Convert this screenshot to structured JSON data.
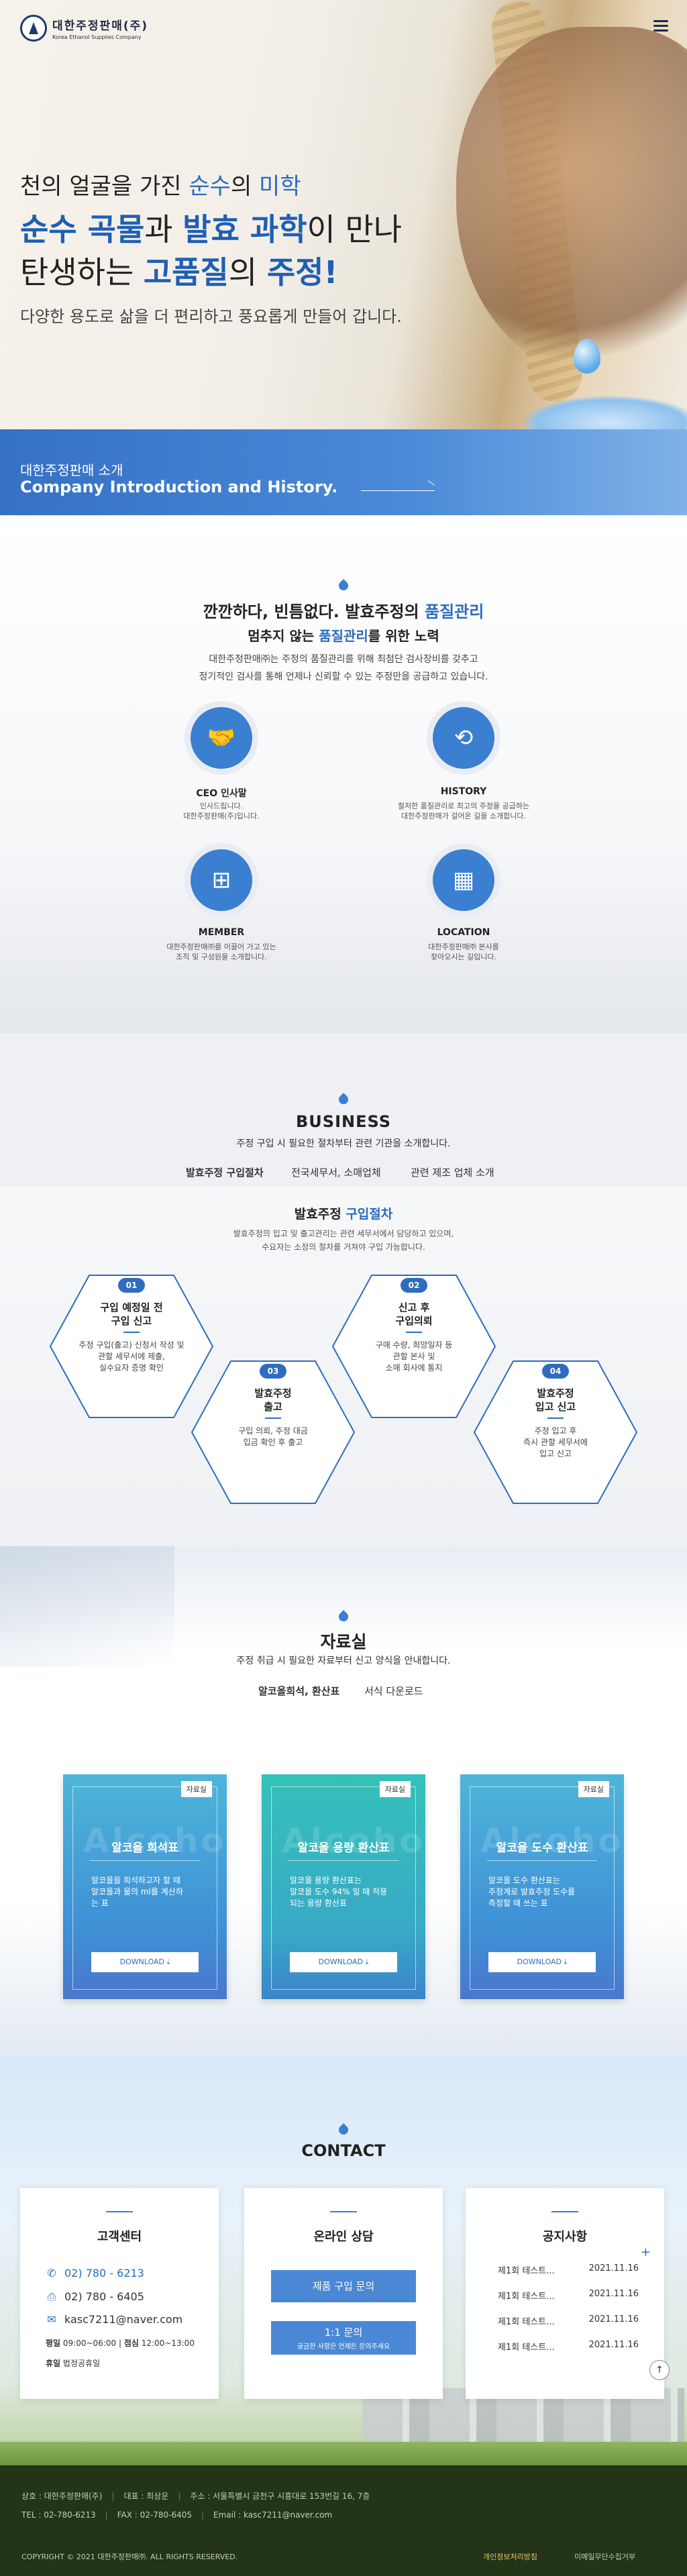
{
  "header": {
    "logo_ko": "대한주정판매(주)",
    "logo_en": "Korea Ethanol Supplies Company"
  },
  "hero": {
    "line1_pre": "천의 얼굴을 가진 ",
    "line1_hl1": "순수",
    "line1_mid": "의 ",
    "line1_hl2": "미학",
    "line2_b1": "순수 곡물",
    "line2_mid": "과 ",
    "line2_b2": "발효 과학",
    "line2_end": "이 만나",
    "line3_pre": "탄생하는 ",
    "line3_b1": "고품질",
    "line3_mid": "의 ",
    "line3_b2": "주정!",
    "sub": "다양한 용도로 삶을 더 편리하고 풍요롭게 만들어 갑니다."
  },
  "intro_band": {
    "ko": "대한주정판매 소개",
    "en": "Company Introduction and History."
  },
  "about": {
    "h1_pre": "깐깐하다, 빈틈없다. 발효주정의 ",
    "h1_hl": "품질관리",
    "h2_pre": "멈추지 않는 ",
    "h2_hl": "품질관리",
    "h2_end": "를 위한 노력",
    "p1": "대한주정판매㈜는 주정의 품질관리를 위해 최첨단 검사장비를 갖추고",
    "p2": "정기적인 검사를 통해 언제나 신뢰할 수 있는 주정만을 공급하고 있습니다.",
    "cards": [
      {
        "title": "CEO 인사말",
        "d1": "인사드립니다.",
        "d2": "대한주정판매(주)입니다.",
        "icon": "handshake-icon"
      },
      {
        "title": "HISTORY",
        "d1": "철저한 품질관리로 최고의 주정을 공급하는",
        "d2": "대한주정판매가 걸어온 길을 소개합니다.",
        "icon": "history-icon"
      },
      {
        "title": "MEMBER",
        "d1": "대한주정판매㈜를 이끌어 가고 있는",
        "d2": "조직 및 구성원을 소개합니다.",
        "icon": "org-chart-icon"
      },
      {
        "title": "LOCATION",
        "d1": "대한주정판매㈜ 본사를",
        "d2": "찾아오시는 길입니다.",
        "icon": "building-icon"
      }
    ]
  },
  "business": {
    "title": "BUSINESS",
    "sub": "주정 구입 시 필요한 절차부터 관련 기관을 소개합니다.",
    "tabs": [
      "발효주정 구입절차",
      "전국세무서, 소매업체",
      "관련 제조 업체 소개"
    ],
    "body_title_pre": "발효주정 ",
    "body_title_hl": "구입절차",
    "p1": "발효주정의 입고 및 출고관리는 관련 세무서에서 담당하고 있으며,",
    "p2": "수요자는 소정의 절차를 거쳐야 구입 가능합니다.",
    "steps": [
      {
        "num": "01",
        "t1": "구입 예정일 전",
        "t2": "구입 신고",
        "d1": "주정 구입(출고) 신청서 작성 및",
        "d2": "관할 세무서에 제출,",
        "d3": "실수요자 증명 확인"
      },
      {
        "num": "02",
        "t1": "신고 후",
        "t2": "구입의뢰",
        "d1": "구매 수량, 희망일자 등",
        "d2": "관할 본사 및",
        "d3": "소매 회사에 통지"
      },
      {
        "num": "03",
        "t1": "발효주정",
        "t2": "출고",
        "d1": "구입 의뢰, 주정 대금",
        "d2": "입금 확인 후 출고",
        "d3": ""
      },
      {
        "num": "04",
        "t1": "발효주정",
        "t2": "입고 신고",
        "d1": "주정 입고 후",
        "d2": "즉시 관할 세무서에",
        "d3": "입고 신고"
      }
    ]
  },
  "data_section": {
    "title": "자료실",
    "sub": "주정 취급 시 필요한 자료부터 신고 양식을 안내합니다.",
    "tabs": [
      "알코올희석, 환산표",
      "서식 다운로드"
    ],
    "cards": [
      {
        "badge": "자료실",
        "bg": "Alcohol",
        "title": "알코올 희석표",
        "d1": "알코올을 희석하고자 할 때",
        "d2": "알코올과 물의 ml를 계산하",
        "d3": "는 표",
        "btn": "DOWNLOAD"
      },
      {
        "badge": "자료실",
        "bg": "Alcohol",
        "title": "알코올 용량 환산표",
        "d1": "알코올 용량 환산표는",
        "d2": "알코올 도수 94% 일 때 적용",
        "d3": "되는 용량 환산표",
        "btn": "DOWNLOAD"
      },
      {
        "badge": "자료실",
        "bg": "Alcohol",
        "title": "알코올 도수 환산표",
        "d1": "알코올 도수 환산표는",
        "d2": "주정계로 발효주정 도수를",
        "d3": "측정할 때 쓰는 표",
        "btn": "DOWNLOAD"
      }
    ]
  },
  "contact": {
    "title": "CONTACT",
    "center_title": "고객센터",
    "phone": "02) 780 - 6213",
    "fax": "02) 780 - 6405",
    "email": "kasc7211@naver.com",
    "hours_label1": "평일",
    "hours1": "09:00~06:00",
    "hours_label2": "점심",
    "hours2": "12:00~13:00",
    "holiday_label": "휴일",
    "holiday": "법정공휴일",
    "online_title": "온라인 상담",
    "btn1": "제품 구입 문의",
    "btn2_l1": "1:1 문의",
    "btn2_l2": "궁금한 사항은 언제든 문의주세요",
    "notice_title": "공지사항",
    "notice_more": "+",
    "notices": [
      {
        "t": "제1회 테스트...",
        "d": "2021.11.16"
      },
      {
        "t": "제1회 테스트...",
        "d": "2021.11.16"
      },
      {
        "t": "제1회 테스트...",
        "d": "2021.11.16"
      },
      {
        "t": "제1회 테스트...",
        "d": "2021.11.16"
      }
    ]
  },
  "footer": {
    "company": "상호 : 대한주정판매(주)",
    "ceo": "대표 : 최상운",
    "addr": "주소 : 서울특별시 금천구 시흥대로 153번길 16, 7층",
    "tel": "TEL : 02-780-6213",
    "fax": "FAX : 02-780-6405",
    "email": "Email : kasc7211@naver.com",
    "copyright": "COPYRIGHT © 2021 대한주정판매㈜. ALL RIGHTS RESERVED.",
    "link1": "개인정보처리방침",
    "link2": "이메일무단수집거부",
    "top_btn": "↑"
  }
}
